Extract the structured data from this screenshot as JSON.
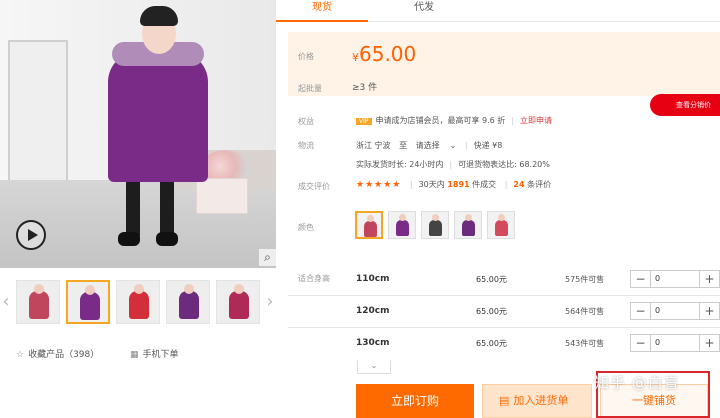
{
  "gallery": {
    "collect_label": "收藏产品（398）",
    "mobile_label": "手机下单",
    "thumbs": [
      {
        "coat_color": "#c0465e"
      },
      {
        "coat_color": "#7a2b87"
      },
      {
        "coat_color": "#d32f3a"
      },
      {
        "coat_color": "#6c2b7c"
      },
      {
        "coat_color": "#b02a58"
      }
    ]
  },
  "tabs": [
    {
      "label": "现货",
      "active": true
    },
    {
      "label": "代发",
      "active": false
    }
  ],
  "price": {
    "label": "价格",
    "currency": "¥",
    "amount": "65.00",
    "min_label": "起批量",
    "min_value": "≥3 件"
  },
  "dist_button": "查看分销价",
  "benefits": {
    "label": "权益",
    "tag": "VIP",
    "text": "申请成为店铺会员，最高可享 9.6 折",
    "link": "立即申请"
  },
  "logistics": {
    "label": "物流",
    "origin": "浙江 宁波",
    "to": "至",
    "dest": "请选择",
    "express": "快递 ¥8",
    "ship_time": "实际发货时长: 24小时内",
    "refund_rate": "可退货物表达比: 68.20%"
  },
  "reviews": {
    "label": "成交评价",
    "stars": "★★★★★",
    "sold_prefix": "30天内",
    "sold_count": "1891",
    "sold_suffix": "件成交",
    "review_count": "24",
    "review_suffix": "条评价"
  },
  "colors": {
    "label": "颜色",
    "swatches": [
      {
        "coat_color": "#c0465e",
        "active": true
      },
      {
        "coat_color": "#7a2b87",
        "active": false
      },
      {
        "coat_color": "#444444",
        "active": false
      },
      {
        "coat_color": "#6c2b7c",
        "active": false
      },
      {
        "coat_color": "#d34a5c",
        "active": false
      }
    ]
  },
  "sizes": {
    "label": "适合身高",
    "rows": [
      {
        "name": "110cm",
        "price": "65.00",
        "unit": "元",
        "stock": "575",
        "stock_suffix": "件可售",
        "qty": "0"
      },
      {
        "name": "120cm",
        "price": "65.00",
        "unit": "元",
        "stock": "564",
        "stock_suffix": "件可售",
        "qty": "0"
      },
      {
        "name": "130cm",
        "price": "65.00",
        "unit": "元",
        "stock": "543",
        "stock_suffix": "件可售",
        "qty": "0"
      }
    ]
  },
  "actions": {
    "buy": "立即订购",
    "cart": "加入进货单",
    "one_key": "一键铺货"
  },
  "watermark": "知乎 @白盲"
}
